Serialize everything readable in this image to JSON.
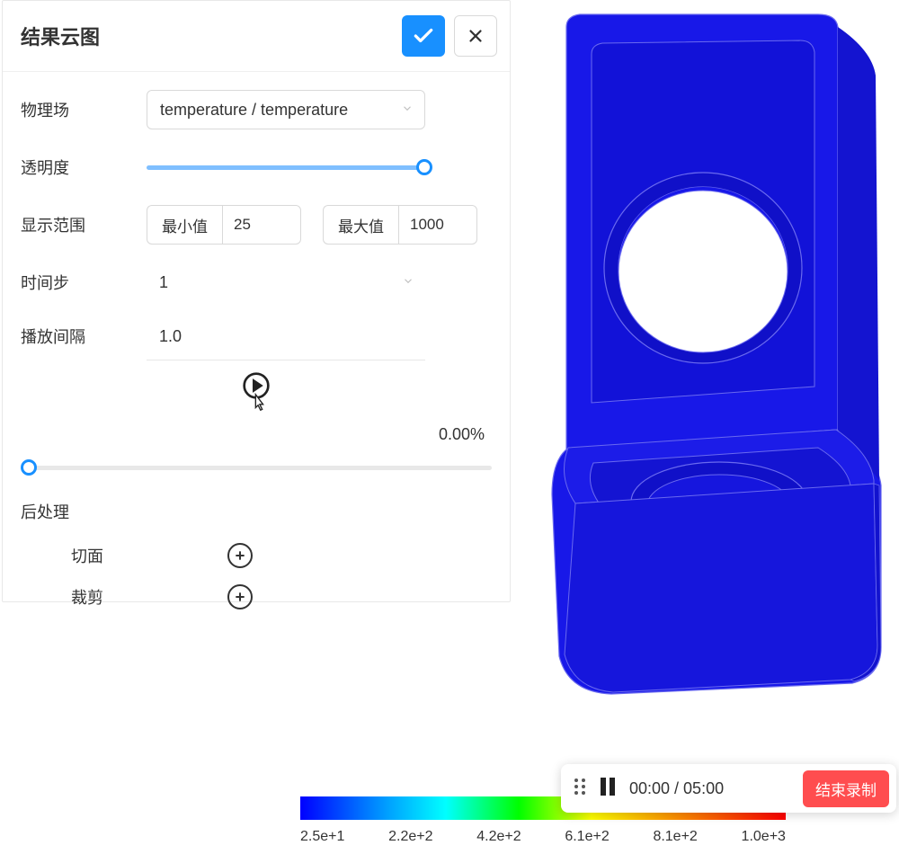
{
  "panel": {
    "title": "结果云图"
  },
  "fields": {
    "physics_label": "物理场",
    "physics_value": "temperature / temperature",
    "transparency_label": "透明度",
    "display_range_label": "显示范围",
    "min_label": "最小值",
    "min_value": "25",
    "max_label": "最大值",
    "max_value": "1000",
    "timestep_label": "时间步",
    "timestep_value": "1",
    "interval_label": "播放间隔",
    "interval_value": "1.0",
    "progress_text": "0.00%"
  },
  "postprocess": {
    "title": "后处理",
    "section_label": "切面",
    "clip_label": "裁剪"
  },
  "legend": {
    "tick0": "2.5e+1",
    "tick1": "2.2e+2",
    "tick2": "4.2e+2",
    "tick3": "6.1e+2",
    "tick4": "8.1e+2",
    "tick5": "1.0e+3"
  },
  "recording": {
    "time": "00:00 / 05:00",
    "stop_label": "结束录制"
  },
  "colors": {
    "primary": "#1890ff",
    "danger": "#ff4d4f",
    "model": "#1818e8"
  }
}
